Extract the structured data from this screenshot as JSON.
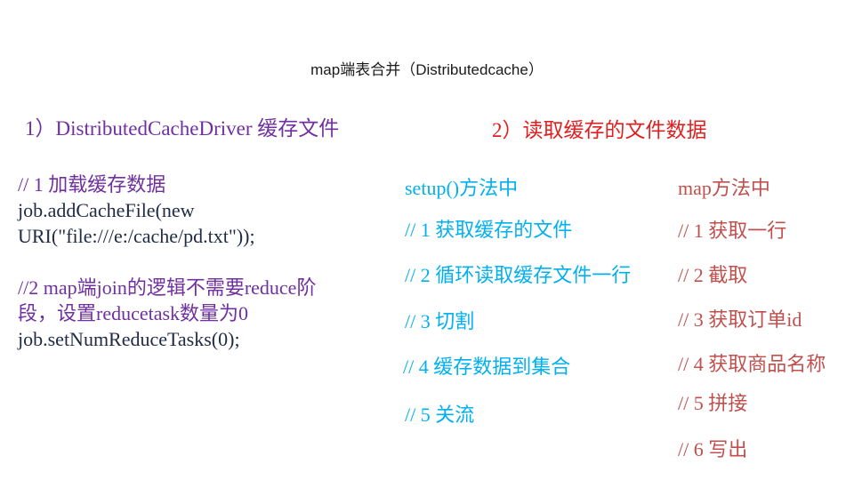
{
  "slide": {
    "title": "map端表合并（Distributedcache）",
    "section1": "1）DistributedCacheDriver 缓存文件",
    "section2": "2）读取缓存的文件数据",
    "code": {
      "comment1": "// 1 加载缓存数据",
      "line1": "job.addCacheFile(new",
      "line2": "URI(\"file:///e:/cache/pd.txt\"));",
      "comment2_a": "//2   map端join的逻辑不需要reduce阶",
      "comment2_b": "段，设置reducetask数量为0",
      "line3": "job.setNumReduceTasks(0);"
    },
    "setup": {
      "title": "setup()方法中",
      "items": [
        "// 1 获取缓存的文件",
        "// 2 循环读取缓存文件一行",
        "// 3 切割",
        "// 4 缓存数据到集合",
        "// 5 关流"
      ]
    },
    "map": {
      "title": "map方法中",
      "items": [
        "// 1 获取一行",
        "// 2 截取",
        "// 3 获取订单id",
        "// 4 获取商品名称",
        "// 5 拼接",
        "// 6 写出"
      ]
    }
  }
}
